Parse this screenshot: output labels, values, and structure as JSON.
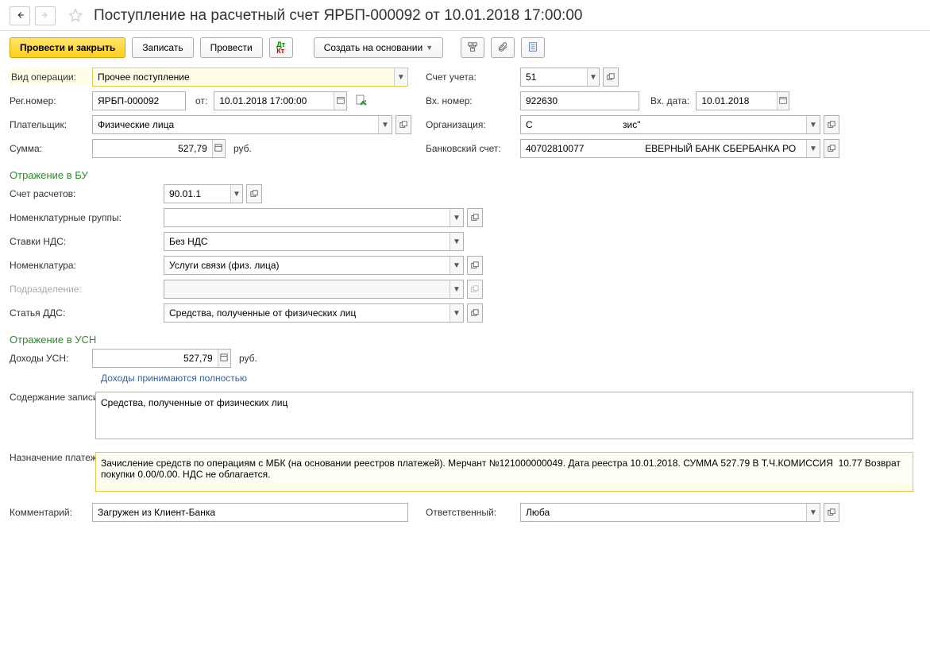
{
  "header": {
    "title": "Поступление на расчетный счет ЯРБП-000092 от 10.01.2018 17:00:00"
  },
  "toolbar": {
    "post_close": "Провести и закрыть",
    "save": "Записать",
    "post": "Провести",
    "create_based": "Создать на основании"
  },
  "labels": {
    "op_type": "Вид операции:",
    "account": "Счет учета:",
    "reg_no": "Рег.номер:",
    "from": "от:",
    "in_no": "Вх. номер:",
    "in_date": "Вх. дата:",
    "payer": "Плательщик:",
    "org": "Организация:",
    "sum": "Сумма:",
    "bank_acc": "Банковский счет:",
    "section_bu": "Отражение в БУ",
    "acc_settl": "Счет расчетов:",
    "nom_groups": "Номенклатурные группы:",
    "vat_rates": "Ставки НДС:",
    "nomenclature": "Номенклатура:",
    "division": "Подразделение:",
    "dds": "Статья ДДС:",
    "section_usn": "Отражение в УСН",
    "usn_income": "Доходы УСН:",
    "usn_note": "Доходы принимаются полностью",
    "kudir": "Содержание записи КУДиР:",
    "purpose": "Назначение платежа:",
    "comment": "Комментарий:",
    "responsible": "Ответственный:",
    "rub": "руб."
  },
  "values": {
    "op_type": "Прочее поступление",
    "account": "51",
    "reg_no": "ЯРБП-000092",
    "date": "10.01.2018 17:00:00",
    "in_no": "922630",
    "in_date": "10.01.2018",
    "payer": "Физические лица",
    "org": "С                                  зис\"",
    "sum": "527,79",
    "bank_acc": "40702810077                       ЕВЕРНЫЙ БАНК СБЕРБАНКА РО",
    "acc_settl": "90.01.1",
    "nom_groups": "",
    "vat_rates": "Без НДС",
    "nomenclature": "Услуги связи (физ. лица)",
    "division": "",
    "dds": "Средства, полученные от физических лиц",
    "usn_income": "527,79",
    "kudir": "Средства, полученные от физических лиц",
    "purpose": "Зачисление средств по операциям с МБК (на основании реестров платежей). Мерчант №121000000049. Дата реестра 10.01.2018. СУММА 527.79 В Т.Ч.КОМИССИЯ  10.77 Возврат покупки 0.00/0.00. НДС не облагается.",
    "comment": "Загружен из Клиент-Банка",
    "responsible": "Люба"
  }
}
